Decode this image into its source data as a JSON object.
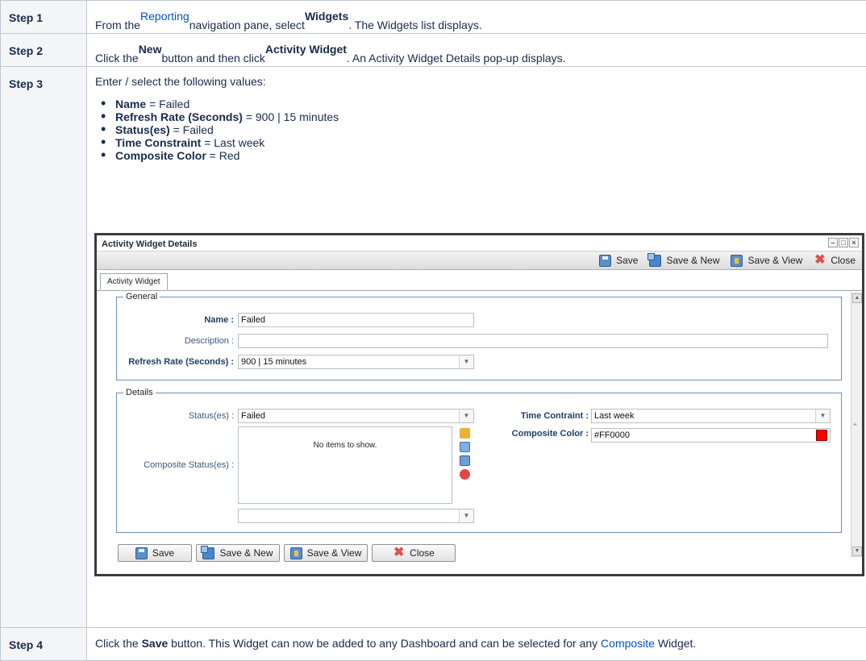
{
  "steps": [
    {
      "label": "Step 1",
      "parts": [
        "From the ",
        "Reporting",
        " navigation pane, select ",
        "Widgets",
        ". The Widgets list displays."
      ]
    },
    {
      "label": "Step 2",
      "parts": [
        "Click the ",
        "New",
        " button and then click ",
        "Activity Widget",
        ". An Activity Widget Details pop-up displays."
      ]
    },
    {
      "label": "Step 3",
      "intro": "Enter / select the following values:",
      "values": [
        {
          "key": "Name",
          "val": " = Failed"
        },
        {
          "key": "Refresh Rate (Seconds)",
          "val": " = 900 | 15 minutes"
        },
        {
          "key": "Status(es)",
          "val": " = Failed"
        },
        {
          "key": "Time Constraint",
          "val": " = Last week"
        },
        {
          "key": "Composite Color",
          "val": " = Red"
        }
      ]
    },
    {
      "label": "Step 4",
      "parts": [
        "Click the ",
        "Save",
        " button. This Widget can now be added to any Dashboard and can be selected for any ",
        "Composite",
        " Widget."
      ]
    }
  ],
  "dialog": {
    "title": "Activity Widget Details",
    "toolbar": {
      "save": "Save",
      "save_new": "Save & New",
      "save_view": "Save & View",
      "close": "Close"
    },
    "tab": "Activity Widget",
    "general": {
      "legend": "General",
      "name_label": "Name :",
      "name_value": "Failed",
      "description_label": "Description :",
      "description_value": "",
      "refresh_label": "Refresh Rate (Seconds) :",
      "refresh_value": "900 | 15 minutes"
    },
    "details": {
      "legend": "Details",
      "status_label": "Status(es) :",
      "status_value": "Failed",
      "composite_status_label": "Composite Status(es) :",
      "empty_list": "No items to show.",
      "composite_select_value": "",
      "time_label": "Time Contraint :",
      "time_value": "Last week",
      "color_label": "Composite Color :",
      "color_value": "#FF0000",
      "swatch_color": "#ff0000"
    },
    "buttons": {
      "save": "Save",
      "save_new": "Save & New",
      "save_view": "Save & View",
      "close": "Close"
    }
  }
}
